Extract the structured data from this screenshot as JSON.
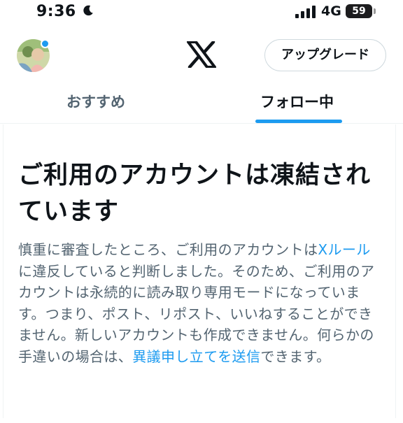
{
  "status_bar": {
    "time": "9:36",
    "network": "4G",
    "battery": "59"
  },
  "header": {
    "upgrade_label": "アップグレード"
  },
  "tabs": [
    {
      "label": "おすすめ",
      "active": false
    },
    {
      "label": "フォロー中",
      "active": true
    }
  ],
  "notice": {
    "title": "ご利用のアカウントは凍結されています",
    "body_part1": "慎重に審査したところ、ご利用のアカウントは",
    "link_rules": "Xルール",
    "body_part2": "に違反していると判断しました。そのため、ご利用のアカウントは永続的に読み取り専用モードになっています。つまり、ポスト、リポスト、いいねすることができません。新しいアカウントも作成できません。何らかの手違いの場合は、",
    "link_appeal": "異議申し立てを送信",
    "body_part3": "できます。"
  },
  "colors": {
    "accent": "#1d9bf0",
    "text_primary": "#0f1419",
    "text_secondary": "#536471"
  },
  "icons": {
    "moon": "moon-icon",
    "signal": "signal-icon",
    "battery": "battery-icon",
    "logo": "x-logo-icon"
  }
}
